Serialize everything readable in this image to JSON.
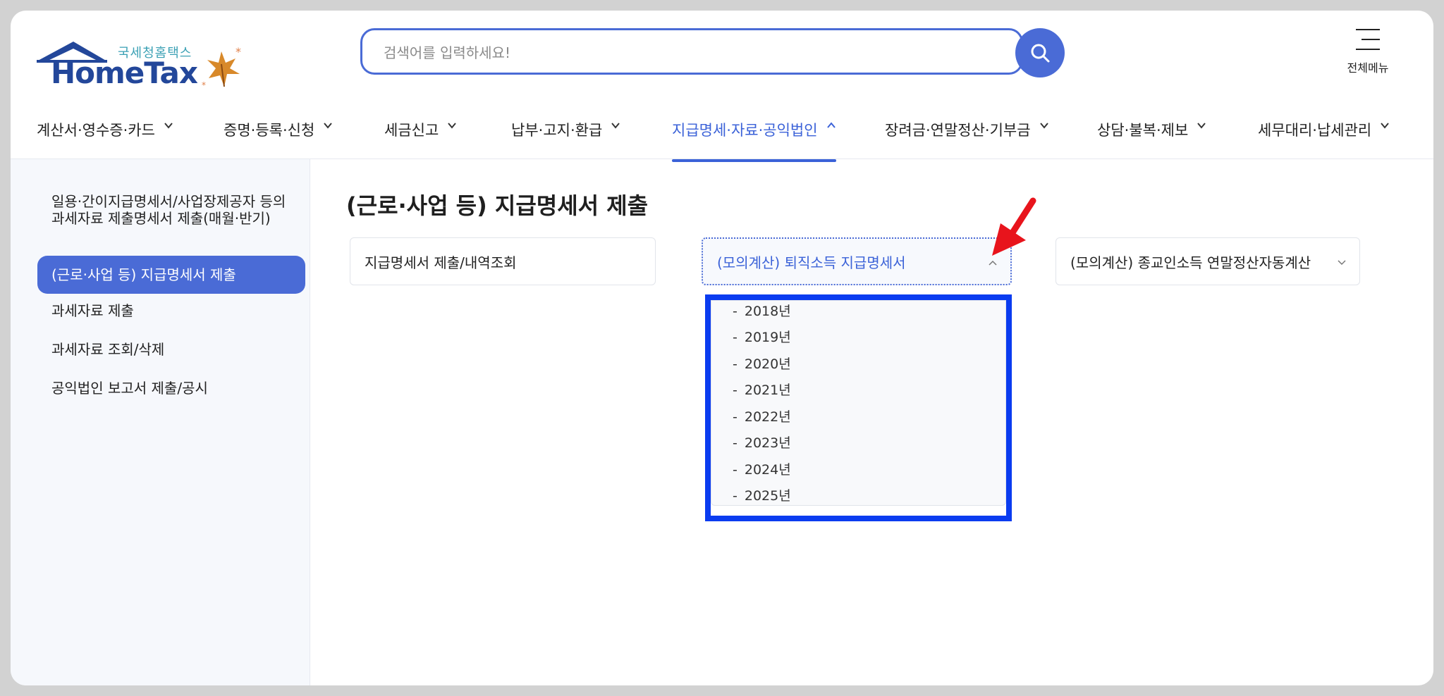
{
  "header": {
    "logo_sub": "국세청홈택스",
    "logo_main": "HomeTax",
    "search_placeholder": "검색어를 입력하세요!",
    "all_menu_label": "전체메뉴"
  },
  "nav": [
    {
      "label": "계산서·영수증·카드",
      "active": false
    },
    {
      "label": "증명·등록·신청",
      "active": false
    },
    {
      "label": "세금신고",
      "active": false
    },
    {
      "label": "납부·고지·환급",
      "active": false
    },
    {
      "label": "지급명세·자료·공익법인",
      "active": true
    },
    {
      "label": "장려금·연말정산·기부금",
      "active": false
    },
    {
      "label": "상담·불복·제보",
      "active": false
    },
    {
      "label": "세무대리·납세관리",
      "active": false
    }
  ],
  "sidebar": {
    "items": [
      {
        "label": "일용·간이지급명세서/사업장제공자 등의 과세자료 제출명세서 제출(매월·반기)",
        "active": false
      },
      {
        "label": "(근로·사업 등) 지급명세서 제출",
        "active": true
      },
      {
        "label": "과세자료 제출",
        "active": false
      },
      {
        "label": "과세자료 조회/삭제",
        "active": false
      },
      {
        "label": "공익법인 보고서 제출/공시",
        "active": false
      }
    ]
  },
  "main": {
    "title": "(근로·사업 등) 지급명세서 제출",
    "selects": [
      {
        "label": "지급명세서 제출/내역조회",
        "open": false
      },
      {
        "label": "(모의계산) 퇴직소득 지급명세서",
        "open": true
      },
      {
        "label": "(모의계산) 종교인소득 연말정산자동계산",
        "open": false
      }
    ],
    "dropdown_dash": "-",
    "dropdown_items": [
      "2018년",
      "2019년",
      "2020년",
      "2021년",
      "2022년",
      "2023년",
      "2024년",
      "2025년"
    ]
  },
  "colors": {
    "accent": "#4a6bd6",
    "active_text": "#3b62d8",
    "highlight_box": "#0a3cf0",
    "annotation_arrow": "#e8141c"
  }
}
